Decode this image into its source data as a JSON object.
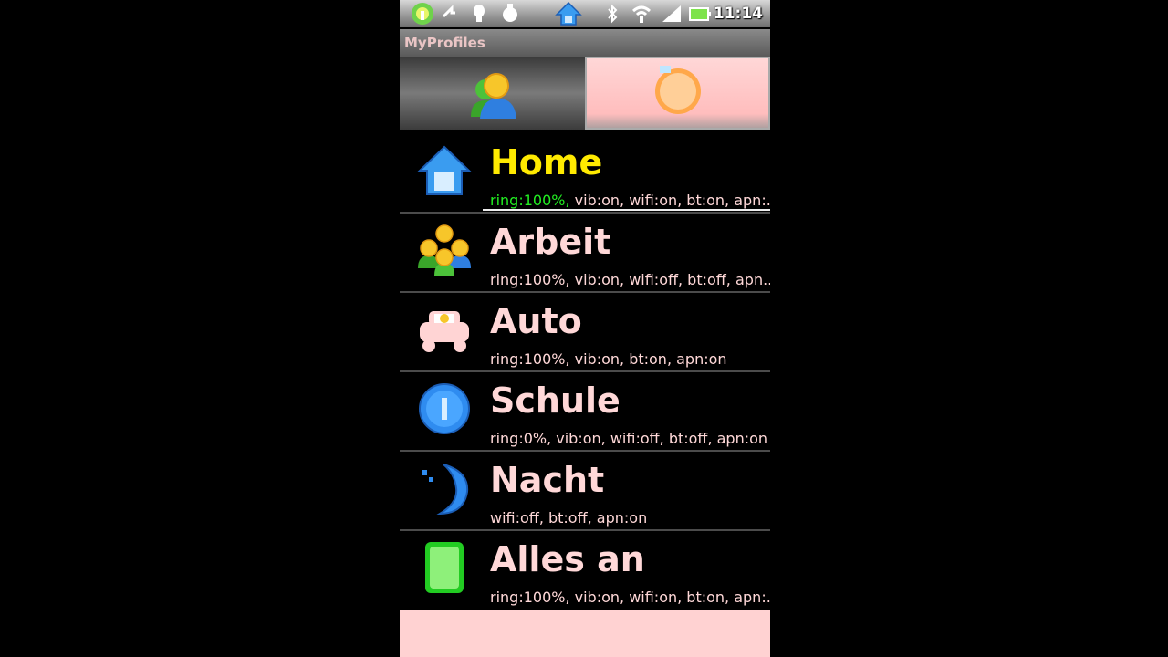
{
  "status_bar": {
    "time": "11:14",
    "icons": [
      "app-icon",
      "arrow-icon",
      "fingerprint-icon",
      "hand-icon",
      "home-notification-icon",
      "bluetooth-icon",
      "wifi-icon",
      "signal-icon",
      "battery-icon"
    ]
  },
  "app": {
    "title": "MyProfiles"
  },
  "tabs": [
    {
      "name": "profiles",
      "icon": "people-icon",
      "selected": false
    },
    {
      "name": "schedule",
      "icon": "clock-icon",
      "selected": true
    }
  ],
  "profiles": [
    {
      "name": "Home",
      "icon": "house-icon",
      "ring": "ring:100%,",
      "detail": " vib:on, wifi:on, bt:on, apn:...",
      "active": true
    },
    {
      "name": "Arbeit",
      "icon": "people-group-icon",
      "detail": "ring:100%, vib:on, wifi:off, bt:off, apn..."
    },
    {
      "name": "Auto",
      "icon": "car-icon",
      "detail": "ring:100%, vib:on, bt:on, apn:on"
    },
    {
      "name": "Schule",
      "icon": "info-icon",
      "detail": "ring:0%, vib:on, wifi:off, bt:off, apn:on"
    },
    {
      "name": "Nacht",
      "icon": "moon-icon",
      "detail": "wifi:off, bt:off, apn:on"
    },
    {
      "name": "Alles an",
      "icon": "green-square-icon",
      "detail": "ring:100%, vib:on, wifi:on, bt:on, apn:..."
    }
  ],
  "colors": {
    "accent_active": "#ffea00",
    "ring_active": "#22ee22",
    "text": "#ffd8d8",
    "panel": "#ffd2d2"
  }
}
